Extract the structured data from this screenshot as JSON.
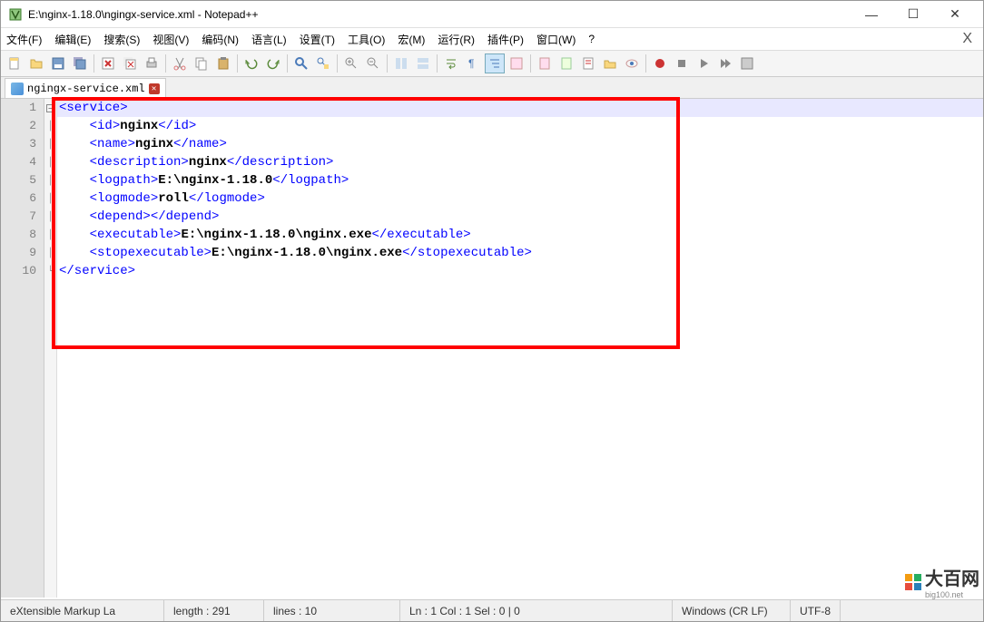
{
  "window": {
    "title": "E:\\nginx-1.18.0\\ngingx-service.xml - Notepad++"
  },
  "menu": {
    "items": [
      "文件(F)",
      "编辑(E)",
      "搜索(S)",
      "视图(V)",
      "编码(N)",
      "语言(L)",
      "设置(T)",
      "工具(O)",
      "宏(M)",
      "运行(R)",
      "插件(P)",
      "窗口(W)",
      "?"
    ]
  },
  "tab": {
    "filename": "ngingx-service.xml"
  },
  "code": {
    "lines": [
      {
        "n": 1,
        "parts": [
          {
            "t": "tag",
            "v": "<service>"
          }
        ],
        "indent": 0,
        "current": true
      },
      {
        "n": 2,
        "parts": [
          {
            "t": "tag",
            "v": "<id>"
          },
          {
            "t": "txt",
            "v": "nginx"
          },
          {
            "t": "tag",
            "v": "</id>"
          }
        ],
        "indent": 1
      },
      {
        "n": 3,
        "parts": [
          {
            "t": "tag",
            "v": "<name>"
          },
          {
            "t": "txt",
            "v": "nginx"
          },
          {
            "t": "tag",
            "v": "</name>"
          }
        ],
        "indent": 1
      },
      {
        "n": 4,
        "parts": [
          {
            "t": "tag",
            "v": "<description>"
          },
          {
            "t": "txt",
            "v": "nginx"
          },
          {
            "t": "tag",
            "v": "</description>"
          }
        ],
        "indent": 1
      },
      {
        "n": 5,
        "parts": [
          {
            "t": "tag",
            "v": "<logpath>"
          },
          {
            "t": "txt",
            "v": "E:\\nginx-1.18.0"
          },
          {
            "t": "tag",
            "v": "</logpath>"
          }
        ],
        "indent": 1
      },
      {
        "n": 6,
        "parts": [
          {
            "t": "tag",
            "v": "<logmode>"
          },
          {
            "t": "txt",
            "v": "roll"
          },
          {
            "t": "tag",
            "v": "</logmode>"
          }
        ],
        "indent": 1
      },
      {
        "n": 7,
        "parts": [
          {
            "t": "tag",
            "v": "<depend>"
          },
          {
            "t": "tag",
            "v": "</depend>"
          }
        ],
        "indent": 1
      },
      {
        "n": 8,
        "parts": [
          {
            "t": "tag",
            "v": "<executable>"
          },
          {
            "t": "txt",
            "v": "E:\\nginx-1.18.0\\nginx.exe"
          },
          {
            "t": "tag",
            "v": "</executable>"
          }
        ],
        "indent": 1
      },
      {
        "n": 9,
        "parts": [
          {
            "t": "tag",
            "v": "<stopexecutable>"
          },
          {
            "t": "txt",
            "v": "E:\\nginx-1.18.0\\nginx.exe"
          },
          {
            "t": "tag",
            "v": "</stopexecutable>"
          }
        ],
        "indent": 1
      },
      {
        "n": 10,
        "parts": [
          {
            "t": "tag",
            "v": "</service>"
          }
        ],
        "indent": 0
      }
    ]
  },
  "status": {
    "lang": "eXtensible Markup La",
    "length_label": "length : 291",
    "lines_label": "lines : 10",
    "pos": "Ln : 1   Col : 1   Sel : 0 | 0",
    "eol": "Windows (CR LF)",
    "encoding": "UTF-8"
  },
  "watermark": {
    "brand": "大百网",
    "sub": "big100.net"
  }
}
